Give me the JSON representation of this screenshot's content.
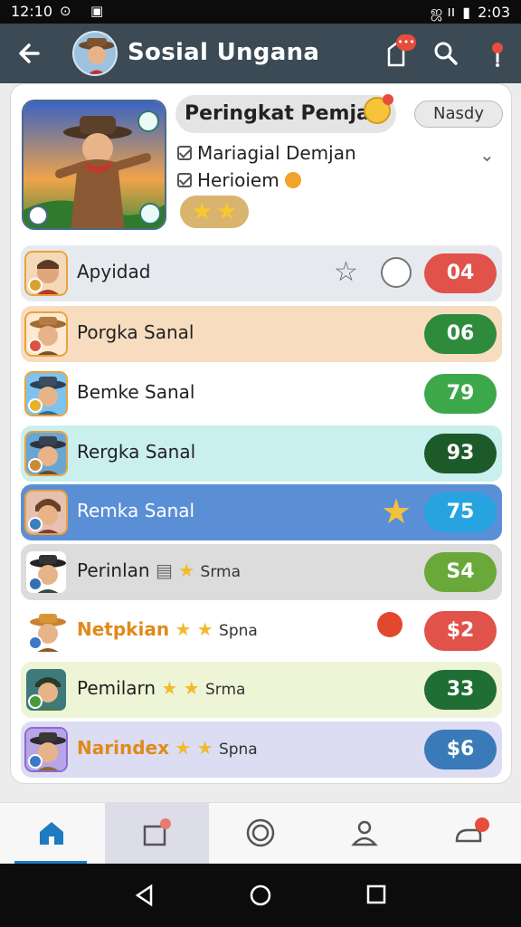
{
  "status_bar": {
    "time_left": "12:10",
    "time_right": "2:03",
    "signal_text": "ஜ ıı",
    "icons": [
      "at-icon",
      "image-icon",
      "signal-icon",
      "battery-icon"
    ]
  },
  "app_bar": {
    "title": "Sosial Ungana",
    "notification_badge": "•••",
    "icons": [
      "back-icon",
      "notification-icon",
      "search-icon",
      "alert-icon"
    ]
  },
  "header_card": {
    "pill_title": "Peringkat Pemjan",
    "next_button": "Nasdy",
    "check_items": [
      "Mariagial Demjan",
      "Herioiem"
    ],
    "stars_count": 2
  },
  "leaderboard": [
    {
      "name": "Apyidad",
      "extra": "",
      "score": "04",
      "score_color": "#e0524a",
      "bg": "#e6eaee",
      "name_color": "#222222",
      "has_star_outline": true,
      "badge": "#d9a133"
    },
    {
      "name": "Porgka Sanal",
      "extra": "",
      "score": "06",
      "score_color": "#2e8b3c",
      "bg": "#f8dcc0",
      "name_color": "#222222",
      "badge": "#d9533f"
    },
    {
      "name": "Bemke Sanal",
      "extra": "",
      "score": "79",
      "score_color": "#3da84a",
      "bg": "#ffffff",
      "name_color": "#222222",
      "badge": "#e3b12b"
    },
    {
      "name": "Rergka Sanal",
      "extra": "",
      "score": "93",
      "score_color": "#1d5a2a",
      "bg": "#c9efef",
      "name_color": "#222222",
      "badge": "#c98b35"
    },
    {
      "name": "Remka Sanal",
      "extra": "",
      "score": "75",
      "score_color": "#27a4e0",
      "bg": "#5a8fd6",
      "name_color": "#ffffff",
      "badge": "#3b7fbf"
    },
    {
      "name": "Perinlan",
      "extra": "Srma",
      "score": "S4",
      "score_color": "#6aa83a",
      "bg": "#dcdcdc",
      "name_color": "#222222",
      "badge": "#3570b6"
    },
    {
      "name": "Netpkian",
      "extra": "Spna",
      "score": "$2",
      "score_color": "#e0524a",
      "bg": "#ffffff",
      "name_color": "#e08a1a",
      "badge": "#3b78c9"
    },
    {
      "name": "Pemilarn",
      "extra": "Srma",
      "score": "33",
      "score_color": "#1f6e34",
      "bg": "#eef4d6",
      "name_color": "#222222",
      "badge": "#4a9a3a"
    },
    {
      "name": "Narindex",
      "extra": "Spna",
      "score": "$6",
      "score_color": "#3a7ab8",
      "bg": "#dcdcf2",
      "name_color": "#e08a1a",
      "badge": "#3b78c9"
    }
  ],
  "bottom_nav": {
    "items": [
      "home-icon",
      "inbox-icon",
      "camera-icon",
      "profile-icon",
      "chat-icon"
    ],
    "active": 0
  },
  "system_nav": [
    "back-triangle-icon",
    "home-circle-icon",
    "recents-square-icon"
  ],
  "colors": {
    "app_bar": "#3b4a54",
    "accent": "#1e7bbf"
  }
}
